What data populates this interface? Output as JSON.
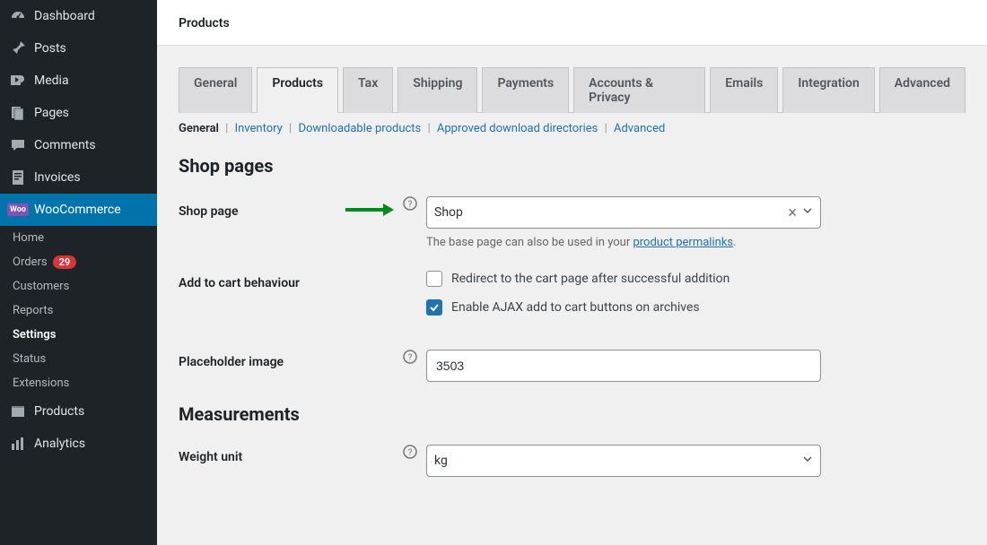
{
  "sidebar": {
    "items": [
      {
        "label": "Dashboard",
        "icon": "dashboard"
      },
      {
        "label": "Posts",
        "icon": "pin"
      },
      {
        "label": "Media",
        "icon": "media"
      },
      {
        "label": "Pages",
        "icon": "pages"
      },
      {
        "label": "Comments",
        "icon": "comments"
      },
      {
        "label": "Invoices",
        "icon": "invoices"
      },
      {
        "label": "WooCommerce",
        "icon": "woo",
        "active": true
      },
      {
        "label": "Products",
        "icon": "products"
      },
      {
        "label": "Analytics",
        "icon": "analytics"
      }
    ],
    "sub": [
      {
        "label": "Home"
      },
      {
        "label": "Orders",
        "badge": "29"
      },
      {
        "label": "Customers"
      },
      {
        "label": "Reports"
      },
      {
        "label": "Settings",
        "current": true
      },
      {
        "label": "Status"
      },
      {
        "label": "Extensions"
      }
    ],
    "woo_badge": "Woo"
  },
  "header": {
    "title": "Products"
  },
  "tabs": [
    "General",
    "Products",
    "Tax",
    "Shipping",
    "Payments",
    "Accounts & Privacy",
    "Emails",
    "Integration",
    "Advanced"
  ],
  "active_tab": "Products",
  "subtabs": [
    "General",
    "Inventory",
    "Downloadable products",
    "Approved download directories",
    "Advanced"
  ],
  "active_subtab": "General",
  "sections": {
    "shop_pages": "Shop pages",
    "measurements": "Measurements"
  },
  "fields": {
    "shop_page": {
      "label": "Shop page",
      "value": "Shop",
      "desc_prefix": "The base page can also be used in your ",
      "desc_link": "product permalinks",
      "desc_suffix": "."
    },
    "add_to_cart": {
      "label": "Add to cart behaviour",
      "opt1": "Redirect to the cart page after successful addition",
      "opt2": "Enable AJAX add to cart buttons on archives"
    },
    "placeholder_image": {
      "label": "Placeholder image",
      "value": "3503"
    },
    "weight_unit": {
      "label": "Weight unit",
      "value": "kg"
    }
  }
}
